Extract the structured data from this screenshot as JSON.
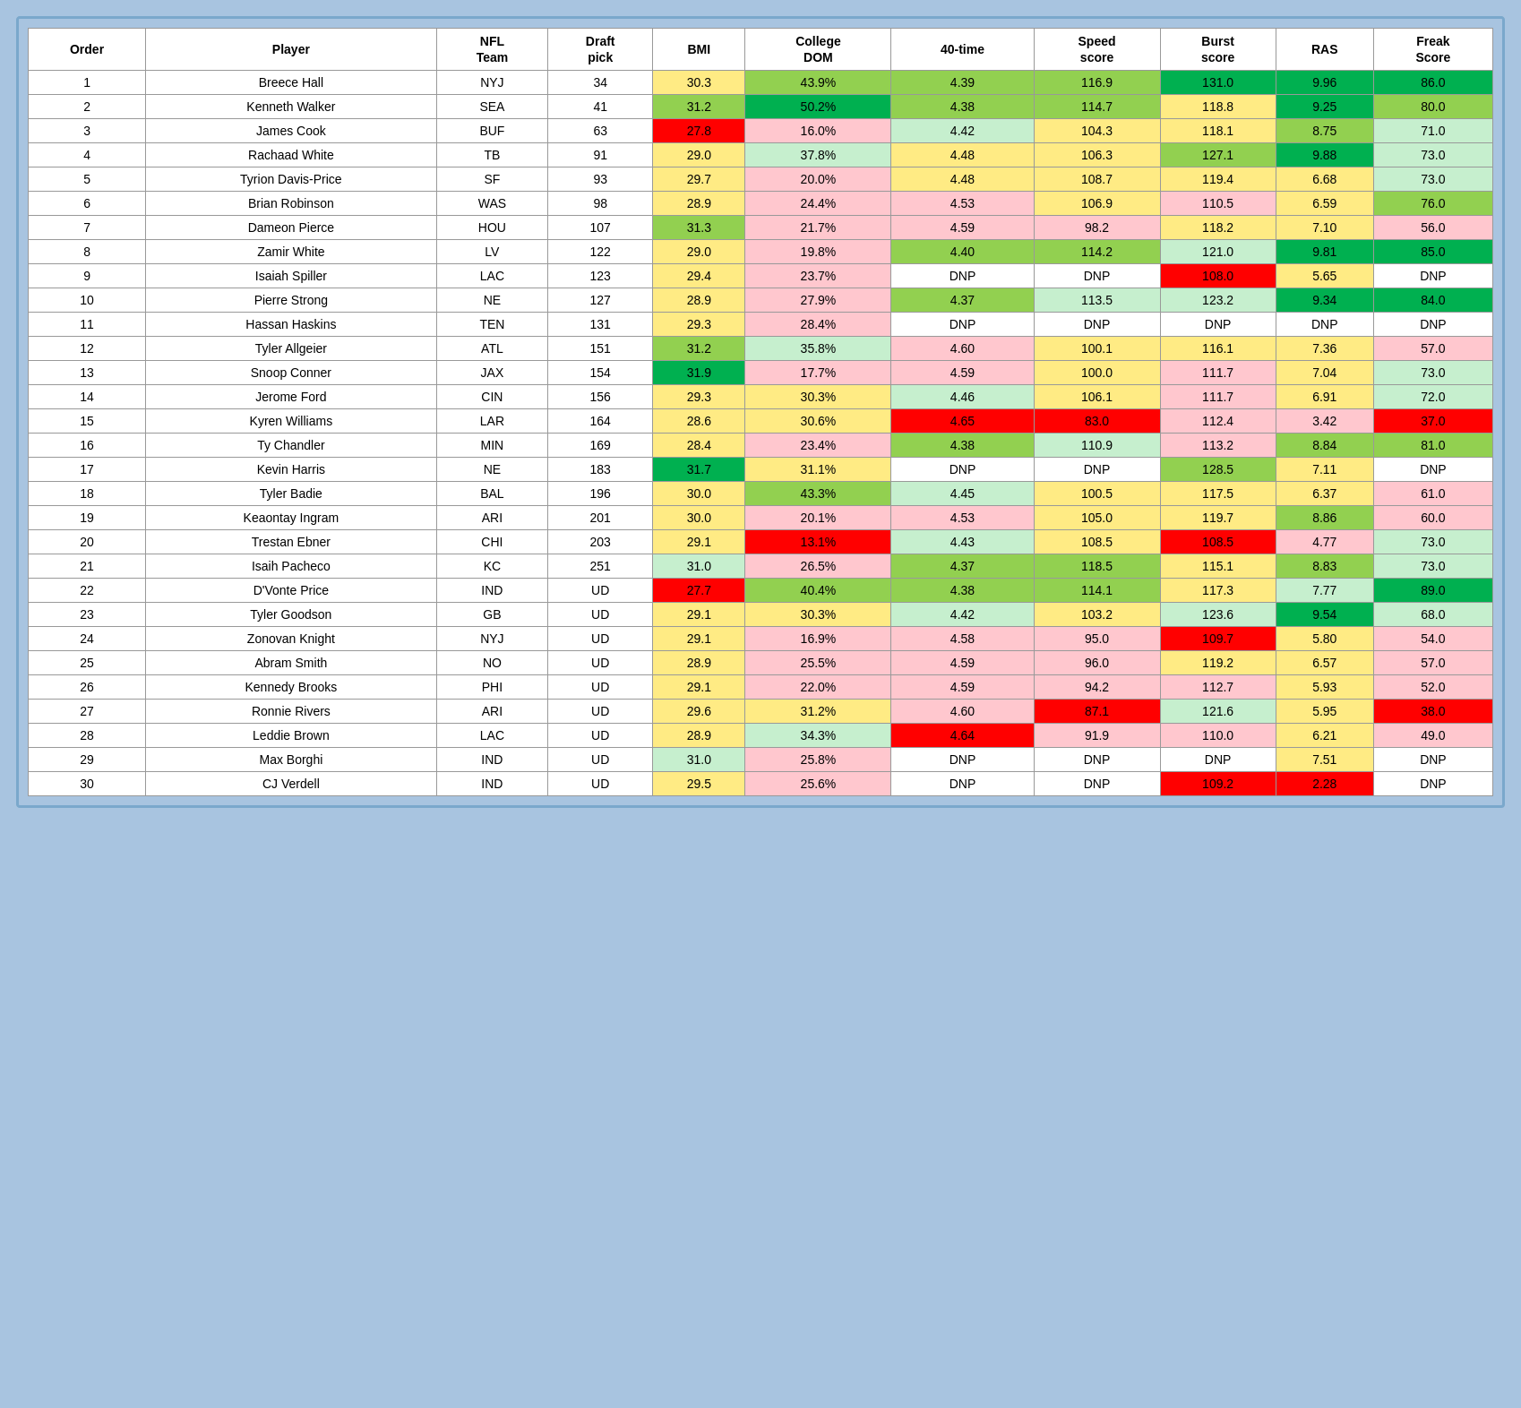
{
  "table": {
    "headers": [
      "Order",
      "Player",
      "NFL Team",
      "Draft pick",
      "BMI",
      "College DOM",
      "40-time",
      "Speed score",
      "Burst score",
      "RAS",
      "Freak Score"
    ],
    "rows": [
      {
        "order": 1,
        "player": "Breece Hall",
        "team": "NYJ",
        "pick": "34",
        "bmi": "30.3",
        "college": "43.9%",
        "time40": "4.39",
        "speed": "116.9",
        "burst": "131.0",
        "ras": "9.96",
        "freak": "86.0",
        "bmi_cls": "cell-yellow",
        "college_cls": "cell-green-med",
        "time40_cls": "cell-green-med",
        "speed_cls": "cell-green-med",
        "burst_cls": "cell-green-dark",
        "ras_cls": "cell-green-dark",
        "freak_cls": "cell-green-dark"
      },
      {
        "order": 2,
        "player": "Kenneth Walker",
        "team": "SEA",
        "pick": "41",
        "bmi": "31.2",
        "college": "50.2%",
        "time40": "4.38",
        "speed": "114.7",
        "burst": "118.8",
        "ras": "9.25",
        "freak": "80.0",
        "bmi_cls": "cell-green-med",
        "college_cls": "cell-green-dark",
        "time40_cls": "cell-green-med",
        "speed_cls": "cell-green-med",
        "burst_cls": "cell-yellow",
        "ras_cls": "cell-green-dark",
        "freak_cls": "cell-green-med"
      },
      {
        "order": 3,
        "player": "James Cook",
        "team": "BUF",
        "pick": "63",
        "bmi": "27.8",
        "college": "16.0%",
        "time40": "4.42",
        "speed": "104.3",
        "burst": "118.1",
        "ras": "8.75",
        "freak": "71.0",
        "bmi_cls": "cell-red",
        "college_cls": "cell-red-light",
        "time40_cls": "cell-green-light",
        "speed_cls": "cell-yellow",
        "burst_cls": "cell-yellow",
        "ras_cls": "cell-green-med",
        "freak_cls": "cell-green-light"
      },
      {
        "order": 4,
        "player": "Rachaad White",
        "team": "TB",
        "pick": "91",
        "bmi": "29.0",
        "college": "37.8%",
        "time40": "4.48",
        "speed": "106.3",
        "burst": "127.1",
        "ras": "9.88",
        "freak": "73.0",
        "bmi_cls": "cell-yellow",
        "college_cls": "cell-green-light",
        "time40_cls": "cell-yellow",
        "speed_cls": "cell-yellow",
        "burst_cls": "cell-green-med",
        "ras_cls": "cell-green-dark",
        "freak_cls": "cell-green-light"
      },
      {
        "order": 5,
        "player": "Tyrion Davis-Price",
        "team": "SF",
        "pick": "93",
        "bmi": "29.7",
        "college": "20.0%",
        "time40": "4.48",
        "speed": "108.7",
        "burst": "119.4",
        "ras": "6.68",
        "freak": "73.0",
        "bmi_cls": "cell-yellow",
        "college_cls": "cell-red-light",
        "time40_cls": "cell-yellow",
        "speed_cls": "cell-yellow",
        "burst_cls": "cell-yellow",
        "ras_cls": "cell-yellow",
        "freak_cls": "cell-green-light"
      },
      {
        "order": 6,
        "player": "Brian Robinson",
        "team": "WAS",
        "pick": "98",
        "bmi": "28.9",
        "college": "24.4%",
        "time40": "4.53",
        "speed": "106.9",
        "burst": "110.5",
        "ras": "6.59",
        "freak": "76.0",
        "bmi_cls": "cell-yellow",
        "college_cls": "cell-red-light",
        "time40_cls": "cell-red-light",
        "speed_cls": "cell-yellow",
        "burst_cls": "cell-red-light",
        "ras_cls": "cell-yellow",
        "freak_cls": "cell-green-med"
      },
      {
        "order": 7,
        "player": "Dameon Pierce",
        "team": "HOU",
        "pick": "107",
        "bmi": "31.3",
        "college": "21.7%",
        "time40": "4.59",
        "speed": "98.2",
        "burst": "118.2",
        "ras": "7.10",
        "freak": "56.0",
        "bmi_cls": "cell-green-med",
        "college_cls": "cell-red-light",
        "time40_cls": "cell-red-light",
        "speed_cls": "cell-red-light",
        "burst_cls": "cell-yellow",
        "ras_cls": "cell-yellow",
        "freak_cls": "cell-red-light"
      },
      {
        "order": 8,
        "player": "Zamir White",
        "team": "LV",
        "pick": "122",
        "bmi": "29.0",
        "college": "19.8%",
        "time40": "4.40",
        "speed": "114.2",
        "burst": "121.0",
        "ras": "9.81",
        "freak": "85.0",
        "bmi_cls": "cell-yellow",
        "college_cls": "cell-red-light",
        "time40_cls": "cell-green-med",
        "speed_cls": "cell-green-med",
        "burst_cls": "cell-green-light",
        "ras_cls": "cell-green-dark",
        "freak_cls": "cell-green-dark"
      },
      {
        "order": 9,
        "player": "Isaiah Spiller",
        "team": "LAC",
        "pick": "123",
        "bmi": "29.4",
        "college": "23.7%",
        "time40": "DNP",
        "speed": "DNP",
        "burst": "108.0",
        "ras": "5.65",
        "freak": "DNP",
        "bmi_cls": "cell-yellow",
        "college_cls": "cell-red-light",
        "time40_cls": "cell-white",
        "speed_cls": "cell-white",
        "burst_cls": "cell-red",
        "ras_cls": "cell-yellow",
        "freak_cls": "cell-white"
      },
      {
        "order": 10,
        "player": "Pierre Strong",
        "team": "NE",
        "pick": "127",
        "bmi": "28.9",
        "college": "27.9%",
        "time40": "4.37",
        "speed": "113.5",
        "burst": "123.2",
        "ras": "9.34",
        "freak": "84.0",
        "bmi_cls": "cell-yellow",
        "college_cls": "cell-red-light",
        "time40_cls": "cell-green-med",
        "speed_cls": "cell-green-light",
        "burst_cls": "cell-green-light",
        "ras_cls": "cell-green-dark",
        "freak_cls": "cell-green-dark"
      },
      {
        "order": 11,
        "player": "Hassan Haskins",
        "team": "TEN",
        "pick": "131",
        "bmi": "29.3",
        "college": "28.4%",
        "time40": "DNP",
        "speed": "DNP",
        "burst": "DNP",
        "ras": "DNP",
        "freak": "DNP",
        "bmi_cls": "cell-yellow",
        "college_cls": "cell-red-light",
        "time40_cls": "cell-white",
        "speed_cls": "cell-white",
        "burst_cls": "cell-white",
        "ras_cls": "cell-white",
        "freak_cls": "cell-white"
      },
      {
        "order": 12,
        "player": "Tyler Allgeier",
        "team": "ATL",
        "pick": "151",
        "bmi": "31.2",
        "college": "35.8%",
        "time40": "4.60",
        "speed": "100.1",
        "burst": "116.1",
        "ras": "7.36",
        "freak": "57.0",
        "bmi_cls": "cell-green-med",
        "college_cls": "cell-green-light",
        "time40_cls": "cell-red-light",
        "speed_cls": "cell-yellow",
        "burst_cls": "cell-yellow",
        "ras_cls": "cell-yellow",
        "freak_cls": "cell-red-light"
      },
      {
        "order": 13,
        "player": "Snoop Conner",
        "team": "JAX",
        "pick": "154",
        "bmi": "31.9",
        "college": "17.7%",
        "time40": "4.59",
        "speed": "100.0",
        "burst": "111.7",
        "ras": "7.04",
        "freak": "73.0",
        "bmi_cls": "cell-green-dark",
        "college_cls": "cell-red-light",
        "time40_cls": "cell-red-light",
        "speed_cls": "cell-yellow",
        "burst_cls": "cell-red-light",
        "ras_cls": "cell-yellow",
        "freak_cls": "cell-green-light"
      },
      {
        "order": 14,
        "player": "Jerome Ford",
        "team": "CIN",
        "pick": "156",
        "bmi": "29.3",
        "college": "30.3%",
        "time40": "4.46",
        "speed": "106.1",
        "burst": "111.7",
        "ras": "6.91",
        "freak": "72.0",
        "bmi_cls": "cell-yellow",
        "college_cls": "cell-yellow",
        "time40_cls": "cell-green-light",
        "speed_cls": "cell-yellow",
        "burst_cls": "cell-red-light",
        "ras_cls": "cell-yellow",
        "freak_cls": "cell-green-light"
      },
      {
        "order": 15,
        "player": "Kyren Williams",
        "team": "LAR",
        "pick": "164",
        "bmi": "28.6",
        "college": "30.6%",
        "time40": "4.65",
        "speed": "83.0",
        "burst": "112.4",
        "ras": "3.42",
        "freak": "37.0",
        "bmi_cls": "cell-yellow",
        "college_cls": "cell-yellow",
        "time40_cls": "cell-red",
        "speed_cls": "cell-red",
        "burst_cls": "cell-red-light",
        "ras_cls": "cell-red-light",
        "freak_cls": "cell-red"
      },
      {
        "order": 16,
        "player": "Ty Chandler",
        "team": "MIN",
        "pick": "169",
        "bmi": "28.4",
        "college": "23.4%",
        "time40": "4.38",
        "speed": "110.9",
        "burst": "113.2",
        "ras": "8.84",
        "freak": "81.0",
        "bmi_cls": "cell-yellow",
        "college_cls": "cell-red-light",
        "time40_cls": "cell-green-med",
        "speed_cls": "cell-green-light",
        "burst_cls": "cell-red-light",
        "ras_cls": "cell-green-med",
        "freak_cls": "cell-green-med"
      },
      {
        "order": 17,
        "player": "Kevin Harris",
        "team": "NE",
        "pick": "183",
        "bmi": "31.7",
        "college": "31.1%",
        "time40": "DNP",
        "speed": "DNP",
        "burst": "128.5",
        "ras": "7.11",
        "freak": "DNP",
        "bmi_cls": "cell-green-dark",
        "college_cls": "cell-yellow",
        "time40_cls": "cell-white",
        "speed_cls": "cell-white",
        "burst_cls": "cell-green-med",
        "ras_cls": "cell-yellow",
        "freak_cls": "cell-white"
      },
      {
        "order": 18,
        "player": "Tyler Badie",
        "team": "BAL",
        "pick": "196",
        "bmi": "30.0",
        "college": "43.3%",
        "time40": "4.45",
        "speed": "100.5",
        "burst": "117.5",
        "ras": "6.37",
        "freak": "61.0",
        "bmi_cls": "cell-yellow",
        "college_cls": "cell-green-med",
        "time40_cls": "cell-green-light",
        "speed_cls": "cell-yellow",
        "burst_cls": "cell-yellow",
        "ras_cls": "cell-yellow",
        "freak_cls": "cell-red-light"
      },
      {
        "order": 19,
        "player": "Keaontay Ingram",
        "team": "ARI",
        "pick": "201",
        "bmi": "30.0",
        "college": "20.1%",
        "time40": "4.53",
        "speed": "105.0",
        "burst": "119.7",
        "ras": "8.86",
        "freak": "60.0",
        "bmi_cls": "cell-yellow",
        "college_cls": "cell-red-light",
        "time40_cls": "cell-red-light",
        "speed_cls": "cell-yellow",
        "burst_cls": "cell-yellow",
        "ras_cls": "cell-green-med",
        "freak_cls": "cell-red-light"
      },
      {
        "order": 20,
        "player": "Trestan Ebner",
        "team": "CHI",
        "pick": "203",
        "bmi": "29.1",
        "college": "13.1%",
        "time40": "4.43",
        "speed": "108.5",
        "burst": "108.5",
        "ras": "4.77",
        "freak": "73.0",
        "bmi_cls": "cell-yellow",
        "college_cls": "cell-red",
        "time40_cls": "cell-green-light",
        "speed_cls": "cell-yellow",
        "burst_cls": "cell-red",
        "ras_cls": "cell-red-light",
        "freak_cls": "cell-green-light"
      },
      {
        "order": 21,
        "player": "Isaih Pacheco",
        "team": "KC",
        "pick": "251",
        "bmi": "31.0",
        "college": "26.5%",
        "time40": "4.37",
        "speed": "118.5",
        "burst": "115.1",
        "ras": "8.83",
        "freak": "73.0",
        "bmi_cls": "cell-green-light",
        "college_cls": "cell-red-light",
        "time40_cls": "cell-green-med",
        "speed_cls": "cell-green-med",
        "burst_cls": "cell-yellow",
        "ras_cls": "cell-green-med",
        "freak_cls": "cell-green-light"
      },
      {
        "order": 22,
        "player": "D'Vonte Price",
        "team": "IND",
        "pick": "UD",
        "bmi": "27.7",
        "college": "40.4%",
        "time40": "4.38",
        "speed": "114.1",
        "burst": "117.3",
        "ras": "7.77",
        "freak": "89.0",
        "bmi_cls": "cell-red",
        "college_cls": "cell-green-med",
        "time40_cls": "cell-green-med",
        "speed_cls": "cell-green-med",
        "burst_cls": "cell-yellow",
        "ras_cls": "cell-green-light",
        "freak_cls": "cell-green-dark"
      },
      {
        "order": 23,
        "player": "Tyler Goodson",
        "team": "GB",
        "pick": "UD",
        "bmi": "29.1",
        "college": "30.3%",
        "time40": "4.42",
        "speed": "103.2",
        "burst": "123.6",
        "ras": "9.54",
        "freak": "68.0",
        "bmi_cls": "cell-yellow",
        "college_cls": "cell-yellow",
        "time40_cls": "cell-green-light",
        "speed_cls": "cell-yellow",
        "burst_cls": "cell-green-light",
        "ras_cls": "cell-green-dark",
        "freak_cls": "cell-green-light"
      },
      {
        "order": 24,
        "player": "Zonovan Knight",
        "team": "NYJ",
        "pick": "UD",
        "bmi": "29.1",
        "college": "16.9%",
        "time40": "4.58",
        "speed": "95.0",
        "burst": "109.7",
        "ras": "5.80",
        "freak": "54.0",
        "bmi_cls": "cell-yellow",
        "college_cls": "cell-red-light",
        "time40_cls": "cell-red-light",
        "speed_cls": "cell-red-light",
        "burst_cls": "cell-red",
        "ras_cls": "cell-yellow",
        "freak_cls": "cell-red-light"
      },
      {
        "order": 25,
        "player": "Abram Smith",
        "team": "NO",
        "pick": "UD",
        "bmi": "28.9",
        "college": "25.5%",
        "time40": "4.59",
        "speed": "96.0",
        "burst": "119.2",
        "ras": "6.57",
        "freak": "57.0",
        "bmi_cls": "cell-yellow",
        "college_cls": "cell-red-light",
        "time40_cls": "cell-red-light",
        "speed_cls": "cell-red-light",
        "burst_cls": "cell-yellow",
        "ras_cls": "cell-yellow",
        "freak_cls": "cell-red-light"
      },
      {
        "order": 26,
        "player": "Kennedy Brooks",
        "team": "PHI",
        "pick": "UD",
        "bmi": "29.1",
        "college": "22.0%",
        "time40": "4.59",
        "speed": "94.2",
        "burst": "112.7",
        "ras": "5.93",
        "freak": "52.0",
        "bmi_cls": "cell-yellow",
        "college_cls": "cell-red-light",
        "time40_cls": "cell-red-light",
        "speed_cls": "cell-red-light",
        "burst_cls": "cell-red-light",
        "ras_cls": "cell-yellow",
        "freak_cls": "cell-red-light"
      },
      {
        "order": 27,
        "player": "Ronnie Rivers",
        "team": "ARI",
        "pick": "UD",
        "bmi": "29.6",
        "college": "31.2%",
        "time40": "4.60",
        "speed": "87.1",
        "burst": "121.6",
        "ras": "5.95",
        "freak": "38.0",
        "bmi_cls": "cell-yellow",
        "college_cls": "cell-yellow",
        "time40_cls": "cell-red-light",
        "speed_cls": "cell-red",
        "burst_cls": "cell-green-light",
        "ras_cls": "cell-yellow",
        "freak_cls": "cell-red"
      },
      {
        "order": 28,
        "player": "Leddie Brown",
        "team": "LAC",
        "pick": "UD",
        "bmi": "28.9",
        "college": "34.3%",
        "time40": "4.64",
        "speed": "91.9",
        "burst": "110.0",
        "ras": "6.21",
        "freak": "49.0",
        "bmi_cls": "cell-yellow",
        "college_cls": "cell-green-light",
        "time40_cls": "cell-red",
        "speed_cls": "cell-red-light",
        "burst_cls": "cell-red-light",
        "ras_cls": "cell-yellow",
        "freak_cls": "cell-red-light"
      },
      {
        "order": 29,
        "player": "Max Borghi",
        "team": "IND",
        "pick": "UD",
        "bmi": "31.0",
        "college": "25.8%",
        "time40": "DNP",
        "speed": "DNP",
        "burst": "DNP",
        "ras": "7.51",
        "freak": "DNP",
        "bmi_cls": "cell-green-light",
        "college_cls": "cell-red-light",
        "time40_cls": "cell-white",
        "speed_cls": "cell-white",
        "burst_cls": "cell-white",
        "ras_cls": "cell-yellow",
        "freak_cls": "cell-white"
      },
      {
        "order": 30,
        "player": "CJ Verdell",
        "team": "IND",
        "pick": "UD",
        "bmi": "29.5",
        "college": "25.6%",
        "time40": "DNP",
        "speed": "DNP",
        "burst": "109.2",
        "ras": "2.28",
        "freak": "DNP",
        "bmi_cls": "cell-yellow",
        "college_cls": "cell-red-light",
        "time40_cls": "cell-white",
        "speed_cls": "cell-white",
        "burst_cls": "cell-red",
        "ras_cls": "cell-red",
        "freak_cls": "cell-white"
      }
    ]
  }
}
